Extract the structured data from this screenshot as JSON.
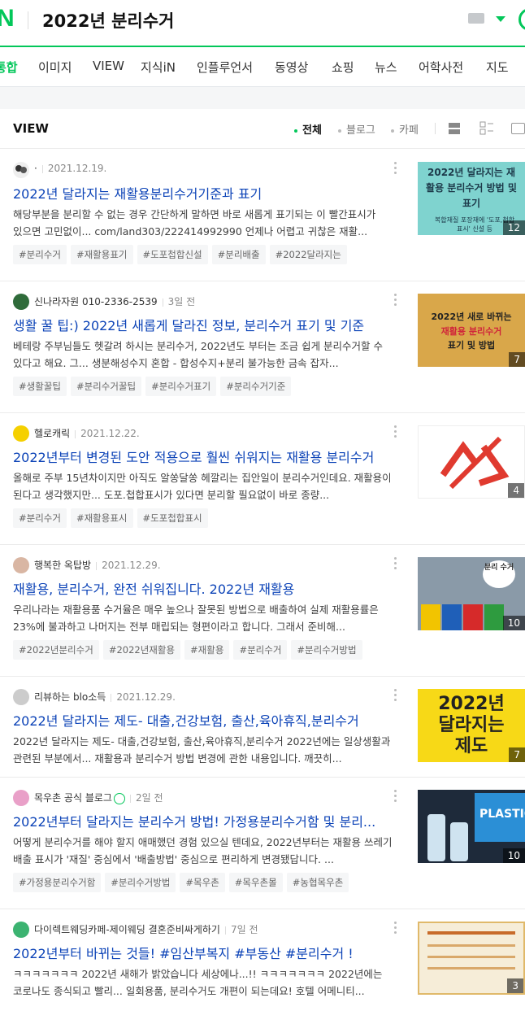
{
  "header": {
    "logo": "N",
    "query": "2022년 분리수거"
  },
  "tabs": [
    "통합",
    "이미지",
    "VIEW",
    "지식iN",
    "인플루언서",
    "동영상",
    "쇼핑",
    "뉴스",
    "어학사전",
    "지도"
  ],
  "view": {
    "title": "VIEW",
    "filters": [
      "전체",
      "블로그",
      "카페"
    ]
  },
  "results": [
    {
      "author": "·",
      "date": "2021.12.19.",
      "title": "2022년 달라지는 재활용분리수거기준과 표기",
      "desc": "해당부분을 분리할 수 없는 경우 간단하게 말하면 바로 새롭게 표기되는 이 빨간표시가 있으면 고민없이... com/land303/222414992990 언제나 어렵고 귀찮은 재활...",
      "tags": [
        "#분리수거",
        "#재활용표기",
        "#도포첩합신설",
        "#분리배출",
        "#2022달라지는"
      ],
      "thumb": {
        "text": "2022년 달라지는 재활용 분리수거 방법 및 표기",
        "sub": "복합재질 포장재에 '도포,첩합표시' 신설 등",
        "count": "12"
      }
    },
    {
      "author": "신나라자원 010-2336-2539",
      "date": "3일 전",
      "title": "생활 꿀 팁:) 2022년 새롭게 달라진 정보, 분리수거 표기 및 기준",
      "desc": "베테랑 주부님들도 헷갈려 하시는 분리수거, 2022년도 부터는 조금 쉽게 분리수거할 수 있다고 해요. 그... 생분해성수지 혼합 - 합성수지+분리 불가능한 금속 잡자...",
      "tags": [
        "#생활꿀팁",
        "#분리수거꿀팁",
        "#분리수거표기",
        "#분리수거기준"
      ],
      "thumb": {
        "text": "2022년 새로 바뀌는",
        "text2": "재활용 분리수거",
        "text3": "표기 및 방법",
        "count": "7"
      }
    },
    {
      "author": "헬로캐릭",
      "date": "2021.12.22.",
      "title": "2022년부터 변경된 도안 적용으로 훨씬 쉬워지는 재활용 분리수거",
      "desc": "올해로 주부 15년차이지만 아직도 알쏭달쏭 헤깔리는 집안일이 분리수거인데요. 재활용이 된다고 생각했지만... 도포.첩합표시가 있다면 분리할 필요없이 바로 종량...",
      "tags": [
        "#분리수거",
        "#재활용표시",
        "#도포첩합표시"
      ],
      "thumb": {
        "count": "4"
      }
    },
    {
      "author": "행복한 옥탑방",
      "date": "2021.12.29.",
      "title": "재활용, 분리수거, 완전 쉬워집니다. 2022년 재활용",
      "desc": "우리나라는 재활용품 수거율은 매우 높으나 잘못된 방법으로 배출하여 실제 재활용률은 23%에 불과하고 나머지는 전부 매립되는 형편이라고 합니다. 그래서 준비해...",
      "tags": [
        "#2022년분리수거",
        "#2022년재활용",
        "#재활용",
        "#분리수거",
        "#분리수거방법"
      ],
      "thumb": {
        "text": "분리 수거",
        "count": "10"
      }
    },
    {
      "author": "리뷰하는 blo소득",
      "date": "2021.12.29.",
      "title": "2022년 달라지는 제도- 대출,건강보험, 출산,육아휴직,분리수거",
      "desc": "2022년 달라지는 제도- 대출,건강보험, 출산,육아휴직,분리수거 2022년에는 일상생활과 관련된 부분에서... 재활용과 분리수거 방법 변경에 관한 내용입니다. 깨끗히...",
      "tags": [],
      "thumb": {
        "text": "2022년",
        "text2": "달라지는",
        "text3": "제도",
        "count": "7"
      }
    },
    {
      "author": "목우촌 공식 블로그",
      "date": "2일 전",
      "title": "2022년부터 달라지는 분리수거 방법! 가정용분리수거함 및 분리...",
      "desc": "어떻게 분리수거를 해야 할지 애매했던 경험 있으실 텐데요, 2022년부터는 재활용 쓰레기 배출 표시가 '재질' 중심에서 '배출방법' 중심으로 편리하게 변경됐답니다. ...",
      "tags": [
        "#가정용분리수거함",
        "#분리수거방법",
        "#목우촌",
        "#목우촌몰",
        "#농협목우촌"
      ],
      "thumb": {
        "text": "PLASTIC",
        "count": "10"
      }
    },
    {
      "author": "다이렉트웨딩카페-제이웨딩 결혼준비싸게하기",
      "date": "7일 전",
      "title": "2022년부터 바뀌는 것들! #임산부복지 #부동산 #분리수거 !",
      "desc": "ㅋㅋㅋㅋㅋㅋㅋ 2022년 새해가 밝았습니다 세상에나...!! ㅋㅋㅋㅋㅋㅋㅋ 2022년에는 코로나도 종식되고 빨리... 일회용품, 분리수거도 개편이 되는데요! 호텔 어메니티...",
      "tags": [],
      "thumb": {
        "count": "3"
      }
    }
  ]
}
